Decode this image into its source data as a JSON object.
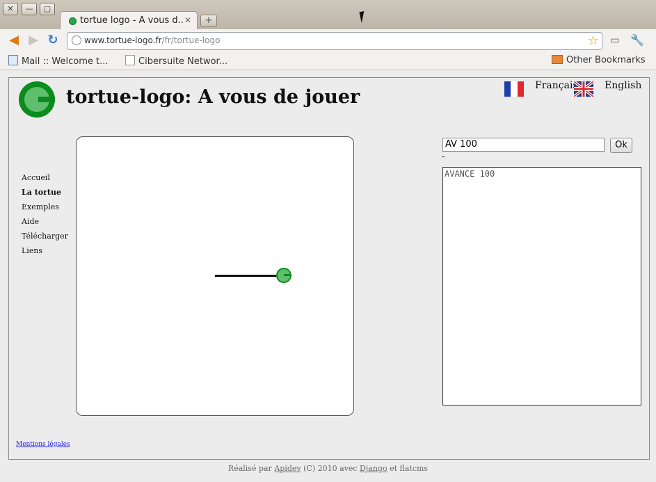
{
  "browser": {
    "window_buttons": {
      "close": "✕",
      "minimize": "—",
      "maximize": "▢"
    },
    "tab": {
      "title": "tortue logo - A vous d...",
      "close": "✕"
    },
    "new_tab": "+",
    "url": {
      "host": "www.tortue-logo.fr",
      "path": "/fr/tortue-logo"
    },
    "bookmarks": [
      {
        "label": "Mail :: Welcome t..."
      },
      {
        "label": "Cibersuite Networ..."
      }
    ],
    "other_bookmarks": "Other Bookmarks"
  },
  "site": {
    "title": "tortue-logo: A vous de jouer",
    "languages": [
      {
        "label": "Français"
      },
      {
        "label": "English"
      }
    ],
    "menu": [
      {
        "label": "Accueil",
        "active": false
      },
      {
        "label": "La tortue",
        "active": true
      },
      {
        "label": "Exemples",
        "active": false
      },
      {
        "label": "Aide",
        "active": false
      },
      {
        "label": "Télécharger",
        "active": false
      },
      {
        "label": "Liens",
        "active": false
      }
    ],
    "command_value": "AV 100",
    "ok_label": "Ok",
    "dash": "-",
    "output_text": "AVANCE 100",
    "mentions": "Mentions légales",
    "footer": {
      "prefix": "Réalisé par ",
      "apidev": "Apidev",
      "middle": " (C) 2010 avec ",
      "django": "Django",
      "suffix": " et flatcms"
    }
  },
  "colors": {
    "logo_green": "#0b8c1c",
    "turtle_fill": "#5fbf6e"
  },
  "icons": [
    "back-arrow-icon",
    "forward-arrow-icon",
    "reload-icon",
    "page-icon",
    "star-icon",
    "page-menu-icon",
    "wrench-icon",
    "mail-icon",
    "document-icon",
    "folder-icon",
    "french-flag-icon",
    "uk-flag-icon"
  ]
}
